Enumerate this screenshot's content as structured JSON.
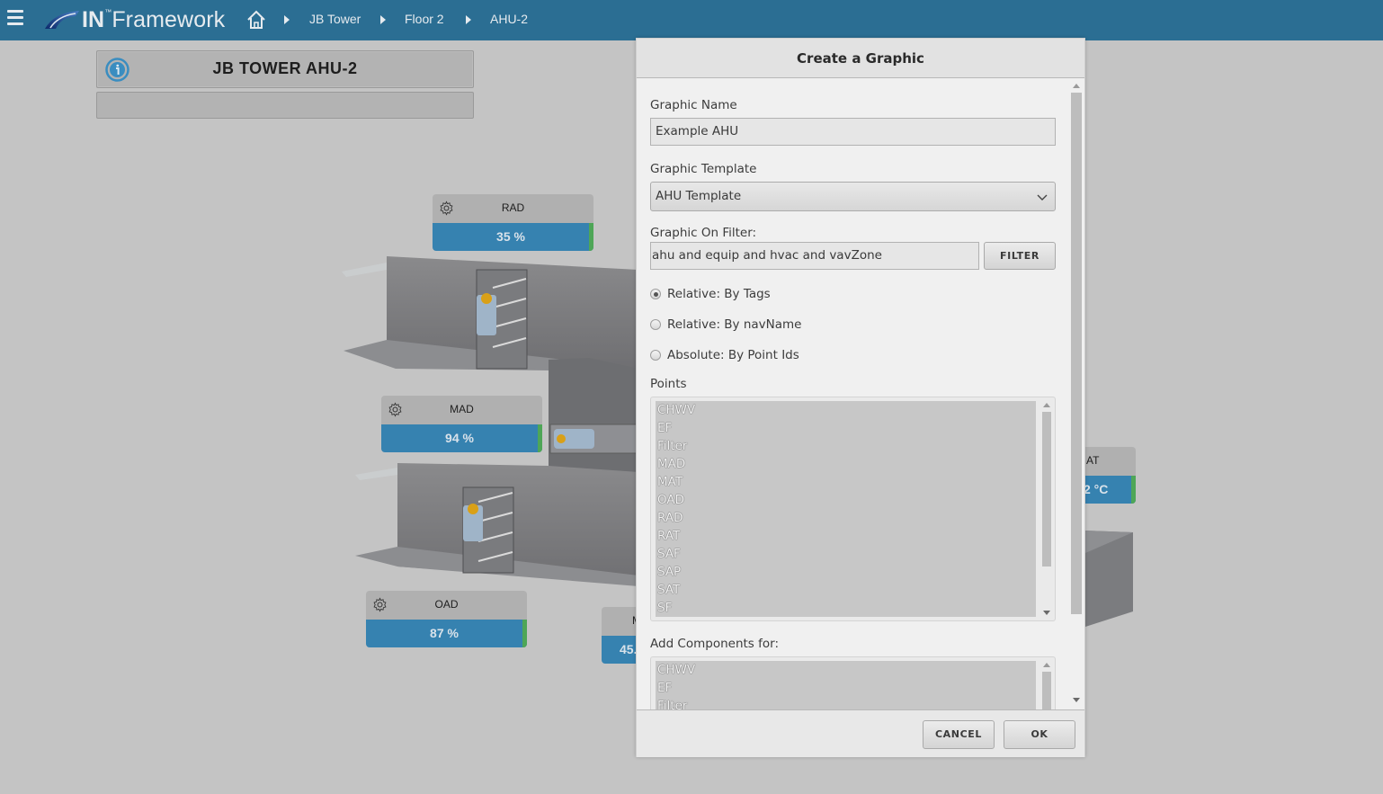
{
  "topbar": {
    "logo_prefix": "IN",
    "logo_tm": "™",
    "logo_suffix": "Framework",
    "breadcrumb": [
      "JB Tower",
      "Floor 2",
      "AHU-2"
    ],
    "color": "#2b6e93"
  },
  "page": {
    "title": "JB TOWER AHU-2",
    "subtitle": ""
  },
  "widgets": [
    {
      "name": "RAD",
      "value": "35 %"
    },
    {
      "name": "MAD",
      "value": "94 %"
    },
    {
      "name": "OAD",
      "value": "87 %"
    },
    {
      "name": "M",
      "value": "45."
    },
    {
      "name": "AT",
      "value": "2 °C"
    }
  ],
  "colors": {
    "value_bar": "#3682b0",
    "status_ok": "#4ea657"
  },
  "dialog": {
    "title": "Create a Graphic",
    "graphic_name_label": "Graphic Name",
    "graphic_name_value": "Example AHU",
    "template_label": "Graphic Template",
    "template_value": "AHU Template",
    "filter_label": "Graphic On Filter:",
    "filter_value": "ahu and equip and hvac and vavZone",
    "filter_button": "FILTER",
    "radios": [
      {
        "label": "Relative: By Tags",
        "checked": true
      },
      {
        "label": "Relative: By navName",
        "checked": false
      },
      {
        "label": "Absolute: By Point Ids",
        "checked": false
      }
    ],
    "points_label": "Points",
    "points": [
      "CHWV",
      "EF",
      "Filter",
      "MAD",
      "MAT",
      "OAD",
      "RAD",
      "RAT",
      "SAF",
      "SAP",
      "SAT",
      "SF"
    ],
    "components_label": "Add Components for:",
    "components": [
      "CHWV",
      "EF",
      "Filter"
    ],
    "cancel_label": "CANCEL",
    "ok_label": "OK"
  }
}
